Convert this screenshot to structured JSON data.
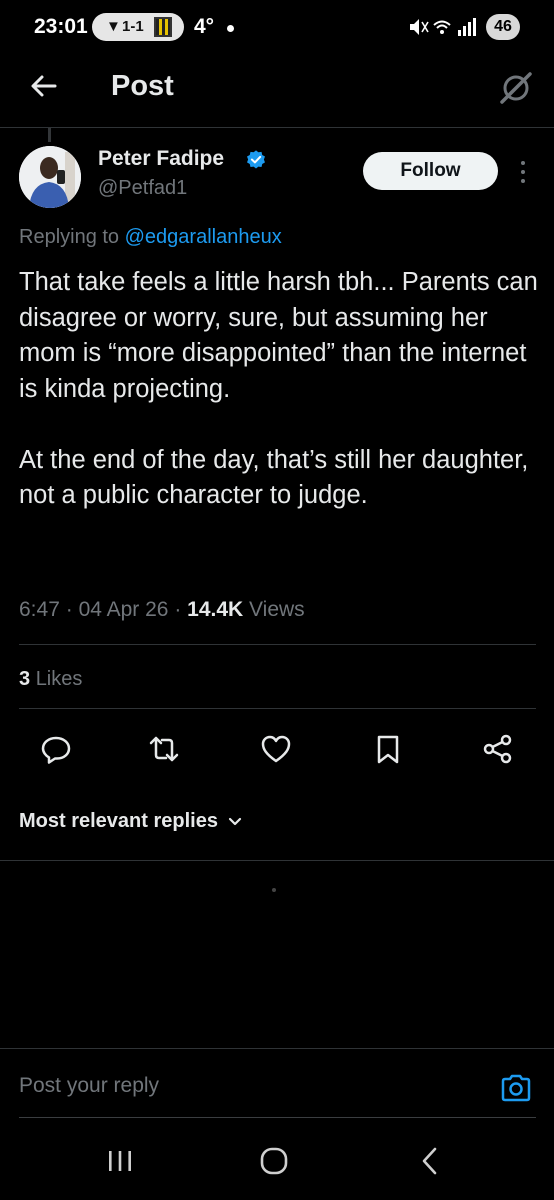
{
  "status_bar": {
    "time": "23:01",
    "match_score": "1-1",
    "temperature": "4°",
    "battery": "46"
  },
  "header": {
    "title": "Post"
  },
  "post": {
    "author_name": "Peter Fadipe",
    "author_handle": "@Petfad1",
    "verified": true,
    "follow_label": "Follow",
    "replying_prefix": "Replying to",
    "replying_handle": "@edgarallanheux",
    "text_paragraphs": [
      "That take feels a little harsh tbh... Parents can disagree or worry, sure, but assuming her mom is “more disappointed” than the internet is kinda projecting.",
      "At the end of the day, that’s still her daughter, not a public character to judge."
    ],
    "time": "6:47",
    "date": "04 Apr 26",
    "separator": "·",
    "views_count": "14.4K",
    "views_label": "Views",
    "likes_count": "3",
    "likes_label": "Likes"
  },
  "actions": [
    "reply-icon",
    "repost-icon",
    "like-icon",
    "bookmark-icon",
    "share-icon"
  ],
  "replies": {
    "sort_label": "Most relevant replies"
  },
  "reply_bar": {
    "placeholder": "Post your reply"
  },
  "colors": {
    "background": "#000000",
    "text": "#e7e9ea",
    "secondary": "#71767b",
    "accent": "#1d9bf0"
  }
}
